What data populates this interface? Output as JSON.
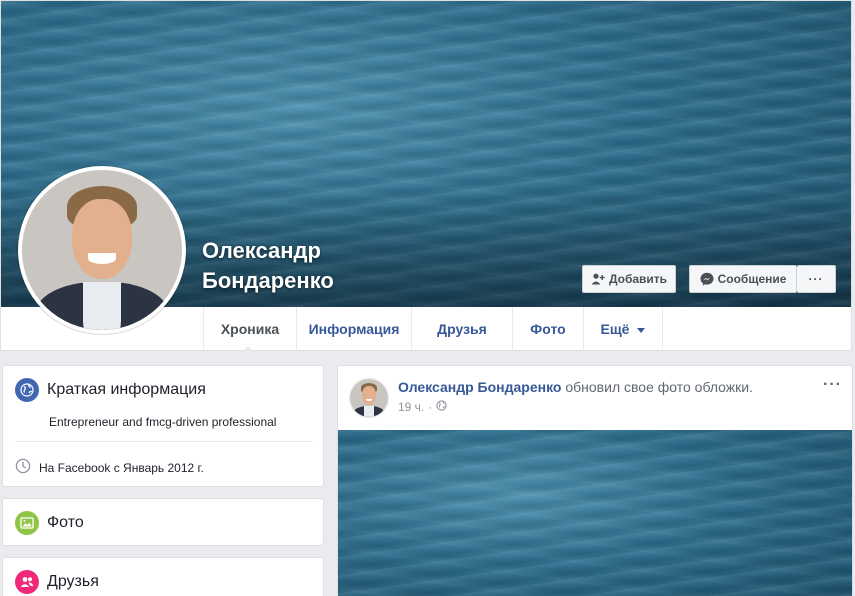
{
  "profile": {
    "name_line1": "Олександр",
    "name_line2": "Бондаренко"
  },
  "cover_actions": {
    "add_friend_label": "Добавить",
    "message_label": "Сообщение",
    "more_label": "···"
  },
  "tabs": [
    {
      "label": "Хроника",
      "active": true
    },
    {
      "label": "Информация"
    },
    {
      "label": "Друзья"
    },
    {
      "label": "Фото"
    },
    {
      "label": "Ещё"
    }
  ],
  "intro": {
    "title": "Краткая информация",
    "bio": "Entrepreneur and fmcg-driven professional",
    "joined": "На Facebook с Январь 2012 г."
  },
  "photos": {
    "title": "Фото"
  },
  "friends": {
    "title": "Друзья"
  },
  "post": {
    "author": "Олександр Бондаренко",
    "action": " обновил свое фото обложки.",
    "time": "19 ч.",
    "options_label": "···"
  },
  "colors": {
    "link": "#365899",
    "intro_icon": "#4267b2",
    "photos_icon": "#8fc447",
    "friends_icon": "#f0287a"
  }
}
